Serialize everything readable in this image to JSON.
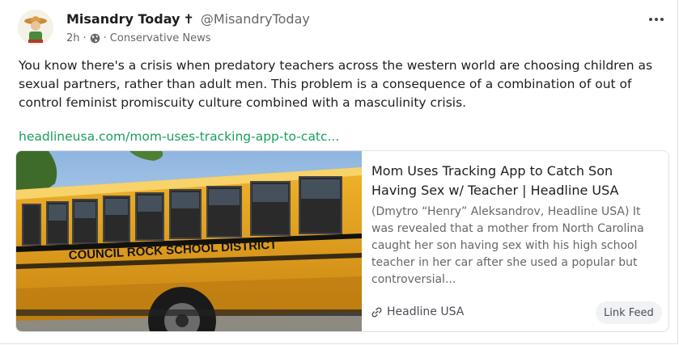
{
  "post": {
    "author_name": "Misandry Today",
    "author_badge": "✝",
    "handle": "@MisandryToday",
    "time": "2h",
    "separator": "·",
    "category": "Conservative News",
    "body": "You know there's a crisis when predatory teachers across the western world are choosing children as sexual partners, rather than adult men. This problem is a consequence of a combination of out of control feminist promiscuity culture combined with a masculinity crisis.",
    "link_text": "headlineusa.com/mom-uses-tracking-app-to-catc..."
  },
  "preview": {
    "bus_lettering": "COUNCIL ROCK SCHOOL DISTRICT",
    "title": "Mom Uses Tracking App to Catch Son Having Sex w/ Teacher | Headline USA",
    "description": "(Dmytro “Henry” Aleksandrov, Headline USA) It was revealed that a mother from North Carolina caught her son having sex with his high school teacher in her car after she used a popular but controversial...",
    "source": "Headline USA",
    "feed_button": "Link Feed"
  },
  "icons": {
    "more": "more-options-icon",
    "globe": "globe-icon",
    "link": "link-icon",
    "cross": "cross-icon"
  },
  "colors": {
    "link": "#1a9e5c",
    "bus_yellow": "#e5a21c",
    "muted": "#65676b"
  }
}
